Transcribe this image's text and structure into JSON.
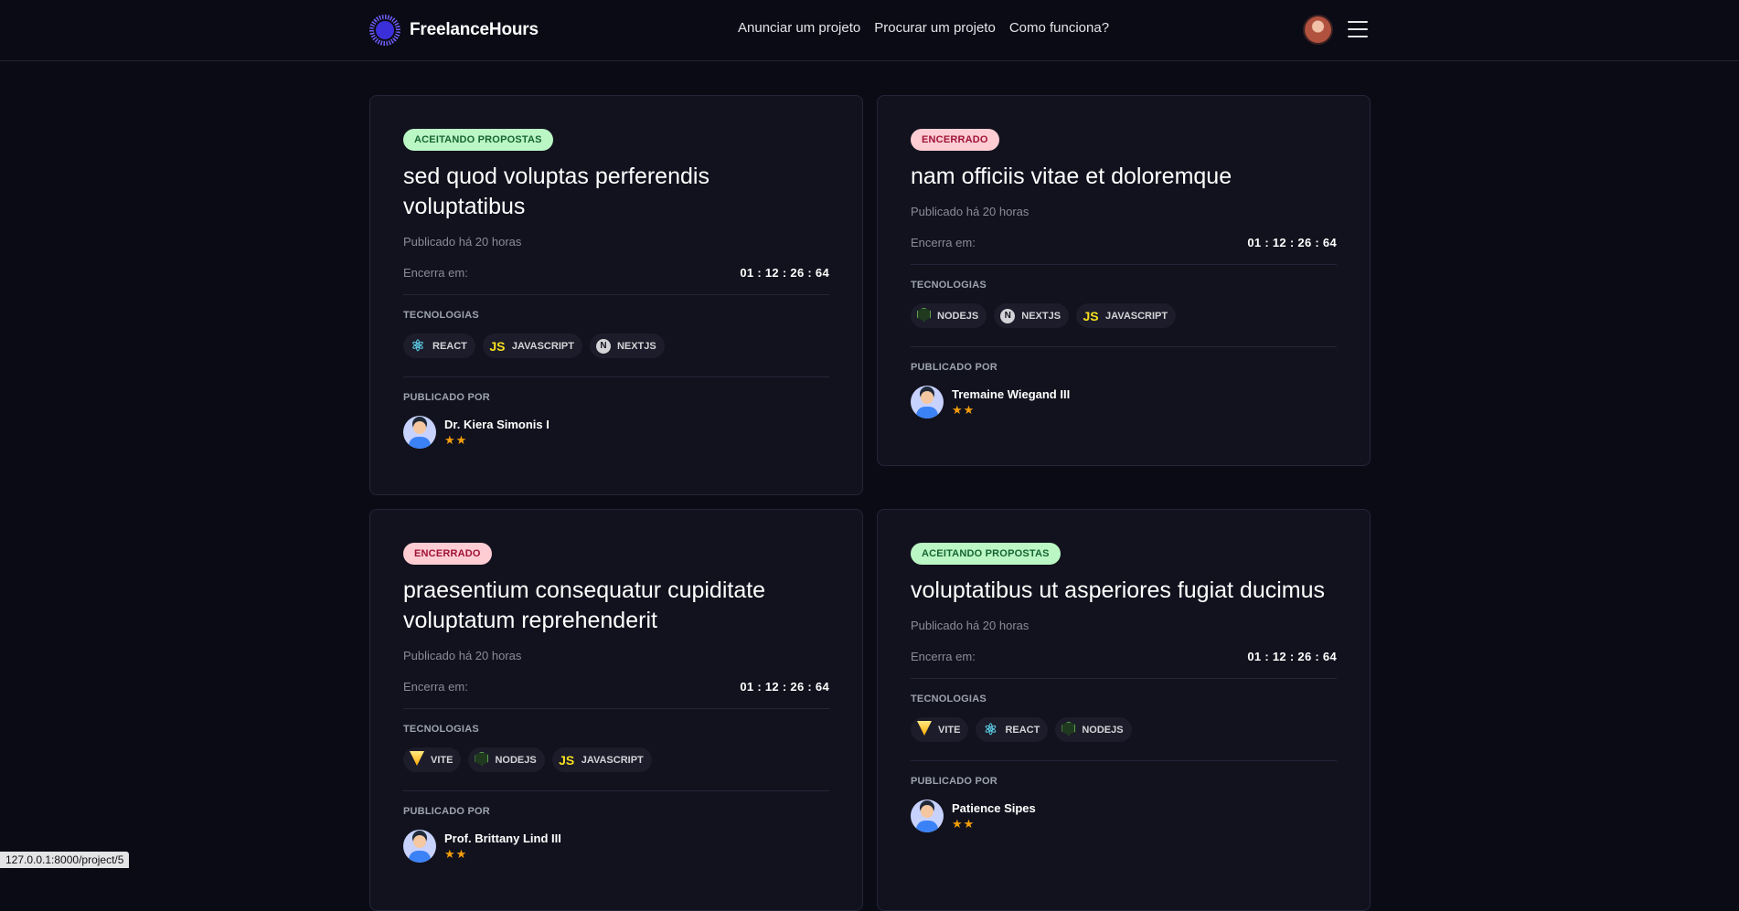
{
  "header": {
    "brand": "FreelanceHours",
    "nav": [
      "Anunciar um projeto",
      "Procurar um projeto",
      "Como funciona?"
    ]
  },
  "labels": {
    "published_prefix": "Publicado há 20 horas",
    "ends_label": "Encerra em:",
    "technologies": "TECNOLOGIAS",
    "published_by": "PUBLICADO POR"
  },
  "projects": [
    {
      "status": "ACEITANDO PROPOSTAS",
      "title": "sed quod voluptas perferendis voluptatibus",
      "published": "Publicado há 20 horas",
      "ends": "Encerra em:",
      "timer": "01 : 12 : 26 : 64",
      "techs": [
        {
          "name": "REACT",
          "icon": "react-icon"
        },
        {
          "name": "JAVASCRIPT",
          "icon": "javascript-icon"
        },
        {
          "name": "NEXTJS",
          "icon": "nextjs-icon"
        }
      ],
      "author": "Dr. Kiera Simonis I",
      "stars": "★★"
    },
    {
      "status": "ENCERRADO",
      "title": "nam officiis vitae et doloremque",
      "published": "Publicado há 20 horas",
      "ends": "Encerra em:",
      "timer": "01 : 12 : 26 : 64",
      "techs": [
        {
          "name": "NODEJS",
          "icon": "nodejs-icon"
        },
        {
          "name": "NEXTJS",
          "icon": "nextjs-icon"
        },
        {
          "name": "JAVASCRIPT",
          "icon": "javascript-icon"
        }
      ],
      "author": "Tremaine Wiegand III",
      "stars": "★★"
    },
    {
      "status": "ENCERRADO",
      "title": "praesentium consequatur cupiditate voluptatum reprehenderit",
      "published": "Publicado há 20 horas",
      "ends": "Encerra em:",
      "timer": "01 : 12 : 26 : 64",
      "techs": [
        {
          "name": "VITE",
          "icon": "vite-icon"
        },
        {
          "name": "NODEJS",
          "icon": "nodejs-icon"
        },
        {
          "name": "JAVASCRIPT",
          "icon": "javascript-icon"
        }
      ],
      "author": "Prof. Brittany Lind III",
      "stars": "★★"
    },
    {
      "status": "ACEITANDO PROPOSTAS",
      "title": "voluptatibus ut asperiores fugiat ducimus",
      "published": "Publicado há 20 horas",
      "ends": "Encerra em:",
      "timer": "01 : 12 : 26 : 64",
      "techs": [
        {
          "name": "VITE",
          "icon": "vite-icon"
        },
        {
          "name": "REACT",
          "icon": "react-icon"
        },
        {
          "name": "NODEJS",
          "icon": "nodejs-icon"
        }
      ],
      "author": "Patience Sipes",
      "stars": "★★"
    }
  ],
  "statusbar": "127.0.0.1:8000/project/5",
  "colors": {
    "background": "#0b0b16",
    "card": "#12121e",
    "status_open_bg": "#bbf7c4",
    "status_closed_bg": "#fecdd3",
    "star": "#f59e0b"
  }
}
